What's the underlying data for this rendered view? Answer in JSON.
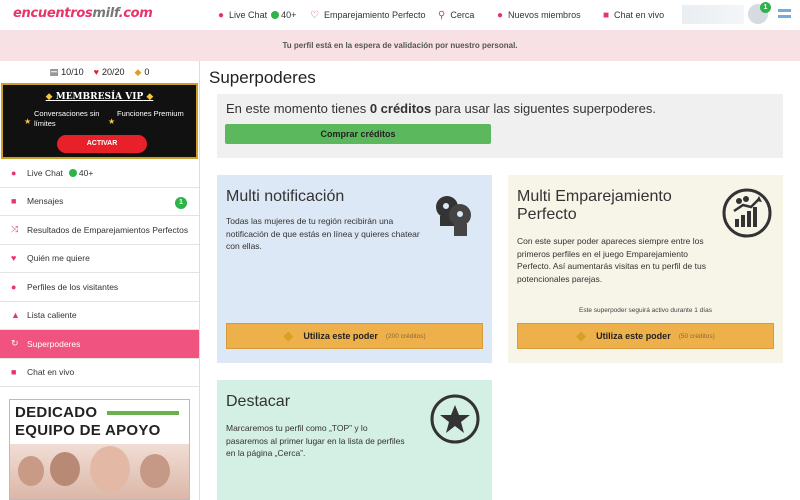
{
  "header": {
    "logo_part1": "encuentros",
    "logo_part2": "milf",
    "logo_part3": ".com",
    "nav": [
      {
        "icon": "chat-bubbles-icon",
        "label": "Live Chat",
        "count": "40+"
      },
      {
        "icon": "heart-outline-icon",
        "label": "Emparejamiento Perfecto"
      },
      {
        "icon": "location-pin-icon",
        "label": "Cerca"
      },
      {
        "icon": "person-icon",
        "label": "Nuevos miembros"
      },
      {
        "icon": "video-camera-icon",
        "label": "Chat en vivo"
      }
    ],
    "avatar_badge": "1"
  },
  "alert": {
    "text": "Tu perfil está en la espera de validación por nuestro personal."
  },
  "sidebar": {
    "stats": {
      "messages": "10/10",
      "likes": "20/20",
      "coins": "0"
    },
    "vip": {
      "title": "MEMBRESÍA VIP",
      "feature1": "Conversaciones sin límites",
      "feature2": "Funciones Premium",
      "button": "ACTIVAR"
    },
    "items": [
      {
        "icon": "chat-bubbles-icon",
        "label": "Live Chat",
        "count": "40+"
      },
      {
        "icon": "envelope-icon",
        "label": "Mensajes",
        "badge": "1"
      },
      {
        "icon": "shuffle-icon",
        "label": "Resultados de Emparejamientos Perfectos"
      },
      {
        "icon": "heart-icon",
        "label": "Quién me quiere"
      },
      {
        "icon": "person-icon",
        "label": "Perfiles de los visitantes"
      },
      {
        "icon": "flame-icon",
        "label": "Lista caliente"
      },
      {
        "icon": "refresh-icon",
        "label": "Superpoderes"
      },
      {
        "icon": "video-camera-icon",
        "label": "Chat en vivo"
      }
    ],
    "support": {
      "line1": "DEDICADO",
      "line2": "EQUIPO DE APOYO"
    }
  },
  "main": {
    "title": "Superpoderes",
    "credits": {
      "text_before": "En este momento tienes ",
      "amount": "0 créditos",
      "text_after": " para usar las siguentes superpoderes.",
      "buy_button": "Comprar créditos"
    },
    "cards": [
      {
        "title": "Multi notificación",
        "description": "Todas las mujeres de tu región recibirán una notificación de que estás en línea y quieres chatear con ellas.",
        "button": "Utiliza este poder",
        "cost": "(200 créditos)",
        "bg": "#dce8f5",
        "icon": "megaphone-heads-icon"
      },
      {
        "title": "Multi Emparejamiento Perfecto",
        "description": "Con este super poder apareces siempre entre los primeros perfiles en el juego Emparejamiento Perfecto. Así aumentarás visitas en tu perfil de tus potencionales parejas.",
        "note": "Este superpoder seguirá activo durante 1 días",
        "button": "Utiliza este poder",
        "cost": "(50 créditos)",
        "bg": "#f7f4e8",
        "icon": "growth-chart-icon"
      },
      {
        "title": "Destacar",
        "description": "Marcaremos tu perfil como „TOP” y lo pasaremos al primer lugar en la lista de perfiles en la página „Cerca”.",
        "bg": "#d4efe3",
        "icon": "star-circle-icon"
      }
    ]
  }
}
